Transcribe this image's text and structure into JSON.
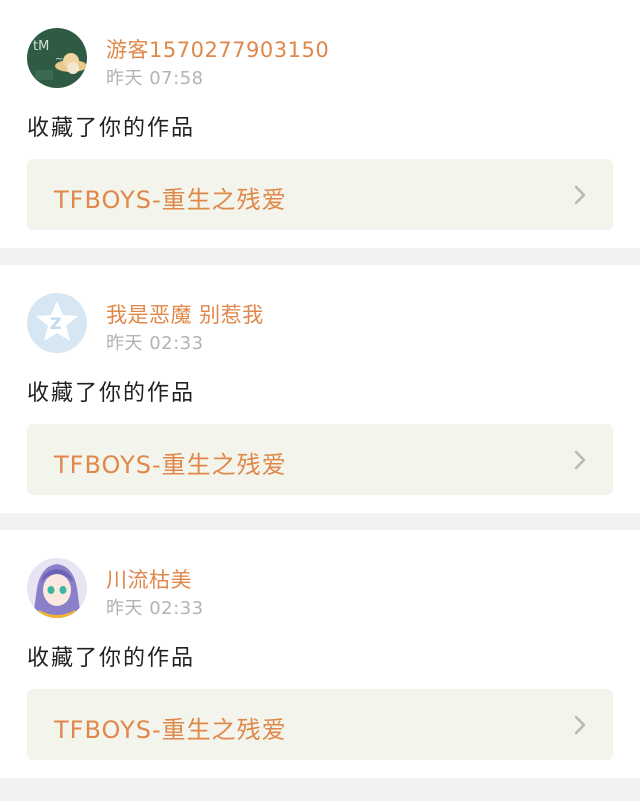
{
  "notifications": [
    {
      "avatar_icon": "chalkboard-hat-avatar-icon",
      "username": "游客1570277903150",
      "time": "昨天 07:58",
      "action": "收藏了你的作品",
      "work_title": "TFBOYS-重生之残爱"
    },
    {
      "avatar_icon": "default-z-star-avatar-icon",
      "username": "我是恶魔 别惹我",
      "time": "昨天 02:33",
      "action": "收藏了你的作品",
      "work_title": "TFBOYS-重生之残爱"
    },
    {
      "avatar_icon": "anime-character-avatar-icon",
      "username": "川流枯美",
      "time": "昨天 02:33",
      "action": "收藏了你的作品",
      "work_title": "TFBOYS-重生之残爱"
    }
  ],
  "colors": {
    "accent": "#e0874a",
    "timestamp": "#b3b3b3",
    "link_bg": "#f3f5ec",
    "divider_bg": "#f2f2f2"
  }
}
